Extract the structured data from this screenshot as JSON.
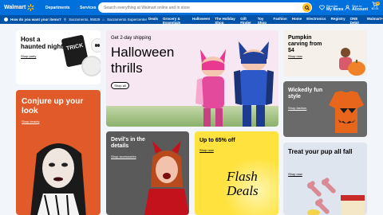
{
  "header": {
    "brand": "Walmart",
    "departments_label": "Departments",
    "services_label": "Services",
    "search_placeholder": "Search everything at Walmart online and in store",
    "reorder_top": "Reorder",
    "reorder_bottom": "My Items",
    "signin_top": "Sign In",
    "signin_bottom": "Account",
    "cart_count": "0",
    "cart_amount": "$0.00"
  },
  "subheader": {
    "delivery_prompt": "How do you want your items?",
    "location": "Sacramento, 95829",
    "store": "Sacramento Supercenter",
    "nav": [
      "Deals",
      "Grocery & Essentials",
      "Halloween",
      "The Holiday Shop",
      "Gift Finder",
      "Toy Shop",
      "Fashion",
      "Home",
      "Electronics",
      "Registry",
      "ONE Debit",
      "Walmart+"
    ]
  },
  "cards": {
    "haunted": {
      "title": "Host a haunted night",
      "link": "Shop party",
      "mug_text": "TRICK"
    },
    "hero": {
      "subtitle": "Get 2-day shipping",
      "title": "Halloween thrills",
      "button": "Shop all"
    },
    "pumpkin": {
      "title": "Pumpkin carving from $4",
      "link": "Shop now"
    },
    "conjure": {
      "title": "Conjure up your look",
      "link": "Shop beauty"
    },
    "wicked": {
      "title": "Wickedly fun style",
      "link": "Shop fashion"
    },
    "devil": {
      "title": "Devil's in the details",
      "link": "Shop accessories"
    },
    "flash": {
      "title": "Up to 65% off",
      "link": "Shop now",
      "big_line1": "Flash",
      "big_line2": "Deals"
    },
    "pup": {
      "title": "Treat your pup all fall",
      "link": "Shop now"
    }
  },
  "colors": {
    "brand_blue": "#0071dc",
    "dark_blue": "#0053a6",
    "spark_yellow": "#ffc220"
  }
}
